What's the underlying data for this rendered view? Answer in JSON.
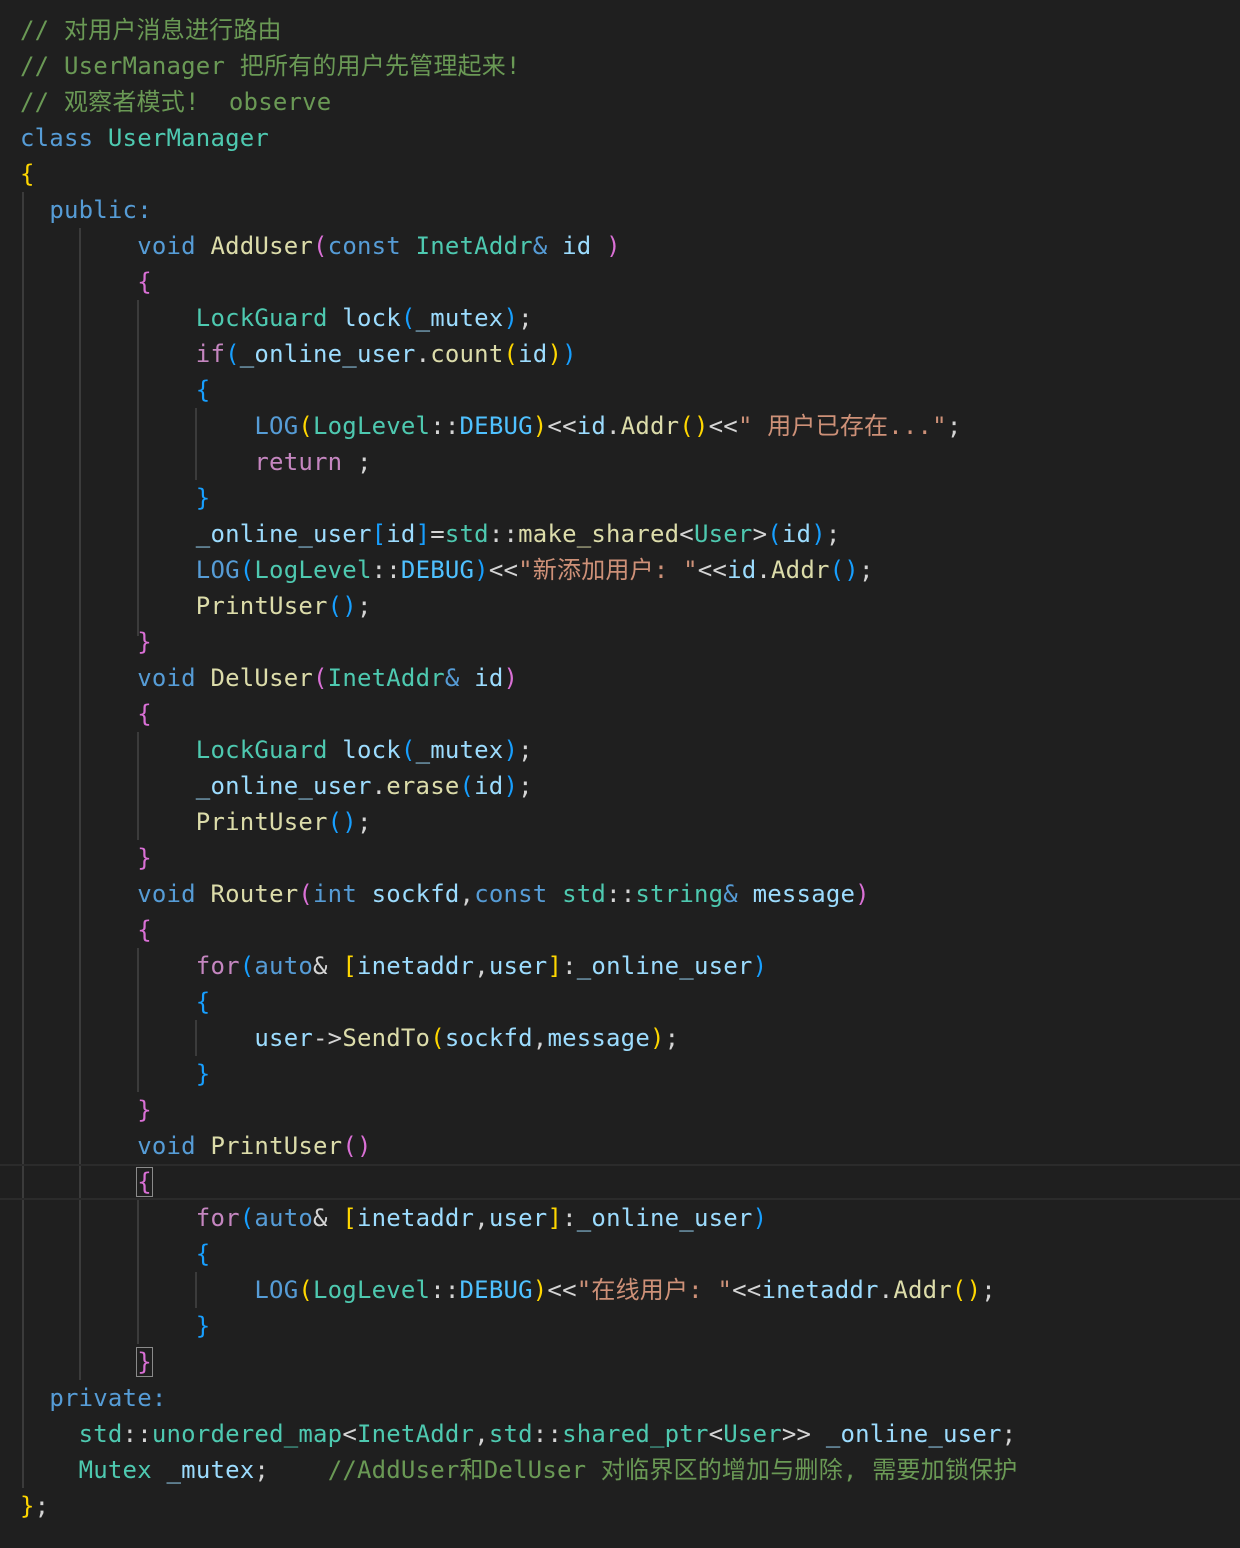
{
  "colors": {
    "background": "#1f1f1f",
    "comment": "#6a9955",
    "keyword": "#569cd6",
    "control": "#c586c0",
    "type": "#4ec9b0",
    "function": "#dcdcaa",
    "variable": "#9cdcfe",
    "string": "#ce9178",
    "punctuation": "#d4d4d4",
    "enum_member": "#4fc1ff",
    "bracket_level_1": "#ffd700",
    "bracket_level_2": "#da70d6",
    "bracket_level_3": "#179fff",
    "indent_guide": "#3b3b3b"
  },
  "code_lines": [
    {
      "tokens": [
        {
          "t": "// 对用户消息进行路由",
          "c": "comment"
        }
      ]
    },
    {
      "tokens": [
        {
          "t": "// UserManager 把所有的用户先管理起来!",
          "c": "comment"
        }
      ]
    },
    {
      "tokens": [
        {
          "t": "// 观察者模式!  observe",
          "c": "comment"
        }
      ]
    },
    {
      "tokens": [
        {
          "t": "class",
          "c": "keyword"
        },
        {
          "t": " ",
          "c": "punc"
        },
        {
          "t": "UserManager",
          "c": "type"
        }
      ]
    },
    {
      "tokens": [
        {
          "t": "{",
          "c": "b1"
        }
      ]
    },
    {
      "tokens": [
        {
          "t": "  ",
          "c": "punc"
        },
        {
          "t": "public",
          "c": "keyword"
        },
        {
          "t": ":",
          "c": "keyword"
        }
      ]
    },
    {
      "tokens": [
        {
          "t": "        ",
          "c": "punc"
        },
        {
          "t": "void",
          "c": "keyword"
        },
        {
          "t": " ",
          "c": "punc"
        },
        {
          "t": "AddUser",
          "c": "func"
        },
        {
          "t": "(",
          "c": "b2"
        },
        {
          "t": "const",
          "c": "keyword"
        },
        {
          "t": " ",
          "c": "punc"
        },
        {
          "t": "InetAddr",
          "c": "type"
        },
        {
          "t": "&",
          "c": "keyword"
        },
        {
          "t": " ",
          "c": "punc"
        },
        {
          "t": "id",
          "c": "var"
        },
        {
          "t": " ",
          "c": "punc"
        },
        {
          "t": ")",
          "c": "b2"
        }
      ]
    },
    {
      "tokens": [
        {
          "t": "        ",
          "c": "punc"
        },
        {
          "t": "{",
          "c": "b2"
        }
      ]
    },
    {
      "tokens": [
        {
          "t": "            ",
          "c": "punc"
        },
        {
          "t": "LockGuard",
          "c": "type"
        },
        {
          "t": " ",
          "c": "punc"
        },
        {
          "t": "lock",
          "c": "var"
        },
        {
          "t": "(",
          "c": "b3"
        },
        {
          "t": "_mutex",
          "c": "var"
        },
        {
          "t": ")",
          "c": "b3"
        },
        {
          "t": ";",
          "c": "punc"
        }
      ]
    },
    {
      "tokens": [
        {
          "t": "            ",
          "c": "punc"
        },
        {
          "t": "if",
          "c": "control"
        },
        {
          "t": "(",
          "c": "b3"
        },
        {
          "t": "_online_user",
          "c": "var"
        },
        {
          "t": ".",
          "c": "punc"
        },
        {
          "t": "count",
          "c": "func"
        },
        {
          "t": "(",
          "c": "b1"
        },
        {
          "t": "id",
          "c": "var"
        },
        {
          "t": ")",
          "c": "b1"
        },
        {
          "t": ")",
          "c": "b3"
        }
      ]
    },
    {
      "tokens": [
        {
          "t": "            ",
          "c": "punc"
        },
        {
          "t": "{",
          "c": "b3"
        }
      ]
    },
    {
      "tokens": [
        {
          "t": "                ",
          "c": "punc"
        },
        {
          "t": "LOG",
          "c": "macro"
        },
        {
          "t": "(",
          "c": "b1"
        },
        {
          "t": "LogLevel",
          "c": "type"
        },
        {
          "t": "::",
          "c": "punc"
        },
        {
          "t": "DEBUG",
          "c": "enum"
        },
        {
          "t": ")",
          "c": "b1"
        },
        {
          "t": "<<",
          "c": "punc"
        },
        {
          "t": "id",
          "c": "var"
        },
        {
          "t": ".",
          "c": "punc"
        },
        {
          "t": "Addr",
          "c": "func"
        },
        {
          "t": "()",
          "c": "b1"
        },
        {
          "t": "<<",
          "c": "punc"
        },
        {
          "t": "\" 用户已存在...\"",
          "c": "string"
        },
        {
          "t": ";",
          "c": "punc"
        }
      ]
    },
    {
      "tokens": [
        {
          "t": "                ",
          "c": "punc"
        },
        {
          "t": "return",
          "c": "control"
        },
        {
          "t": " ;",
          "c": "punc"
        }
      ]
    },
    {
      "tokens": [
        {
          "t": "            ",
          "c": "punc"
        },
        {
          "t": "}",
          "c": "b3"
        }
      ]
    },
    {
      "tokens": [
        {
          "t": "            ",
          "c": "punc"
        },
        {
          "t": "_online_user",
          "c": "var"
        },
        {
          "t": "[",
          "c": "b3"
        },
        {
          "t": "id",
          "c": "var"
        },
        {
          "t": "]",
          "c": "b3"
        },
        {
          "t": "=",
          "c": "punc"
        },
        {
          "t": "std",
          "c": "type"
        },
        {
          "t": "::",
          "c": "punc"
        },
        {
          "t": "make_shared",
          "c": "func"
        },
        {
          "t": "<",
          "c": "punc"
        },
        {
          "t": "User",
          "c": "type"
        },
        {
          "t": ">",
          "c": "punc"
        },
        {
          "t": "(",
          "c": "b3"
        },
        {
          "t": "id",
          "c": "var"
        },
        {
          "t": ")",
          "c": "b3"
        },
        {
          "t": ";",
          "c": "punc"
        }
      ]
    },
    {
      "tokens": [
        {
          "t": "            ",
          "c": "punc"
        },
        {
          "t": "LOG",
          "c": "macro"
        },
        {
          "t": "(",
          "c": "b3"
        },
        {
          "t": "LogLevel",
          "c": "type"
        },
        {
          "t": "::",
          "c": "punc"
        },
        {
          "t": "DEBUG",
          "c": "enum"
        },
        {
          "t": ")",
          "c": "b3"
        },
        {
          "t": "<<",
          "c": "punc"
        },
        {
          "t": "\"新添加用户: \"",
          "c": "string"
        },
        {
          "t": "<<",
          "c": "punc"
        },
        {
          "t": "id",
          "c": "var"
        },
        {
          "t": ".",
          "c": "punc"
        },
        {
          "t": "Addr",
          "c": "func"
        },
        {
          "t": "()",
          "c": "b3"
        },
        {
          "t": ";",
          "c": "punc"
        }
      ]
    },
    {
      "tokens": [
        {
          "t": "            ",
          "c": "punc"
        },
        {
          "t": "PrintUser",
          "c": "func"
        },
        {
          "t": "()",
          "c": "b3"
        },
        {
          "t": ";",
          "c": "punc"
        }
      ]
    },
    {
      "tokens": [
        {
          "t": "        ",
          "c": "punc"
        },
        {
          "t": "}",
          "c": "b2"
        }
      ]
    },
    {
      "tokens": [
        {
          "t": "        ",
          "c": "punc"
        },
        {
          "t": "void",
          "c": "keyword"
        },
        {
          "t": " ",
          "c": "punc"
        },
        {
          "t": "DelUser",
          "c": "func"
        },
        {
          "t": "(",
          "c": "b2"
        },
        {
          "t": "InetAddr",
          "c": "type"
        },
        {
          "t": "&",
          "c": "keyword"
        },
        {
          "t": " ",
          "c": "punc"
        },
        {
          "t": "id",
          "c": "var"
        },
        {
          "t": ")",
          "c": "b2"
        }
      ]
    },
    {
      "tokens": [
        {
          "t": "        ",
          "c": "punc"
        },
        {
          "t": "{",
          "c": "b2"
        }
      ]
    },
    {
      "tokens": [
        {
          "t": "            ",
          "c": "punc"
        },
        {
          "t": "LockGuard",
          "c": "type"
        },
        {
          "t": " ",
          "c": "punc"
        },
        {
          "t": "lock",
          "c": "var"
        },
        {
          "t": "(",
          "c": "b3"
        },
        {
          "t": "_mutex",
          "c": "var"
        },
        {
          "t": ")",
          "c": "b3"
        },
        {
          "t": ";",
          "c": "punc"
        }
      ]
    },
    {
      "tokens": [
        {
          "t": "            ",
          "c": "punc"
        },
        {
          "t": "_online_user",
          "c": "var"
        },
        {
          "t": ".",
          "c": "punc"
        },
        {
          "t": "erase",
          "c": "func"
        },
        {
          "t": "(",
          "c": "b3"
        },
        {
          "t": "id",
          "c": "var"
        },
        {
          "t": ")",
          "c": "b3"
        },
        {
          "t": ";",
          "c": "punc"
        }
      ]
    },
    {
      "tokens": [
        {
          "t": "            ",
          "c": "punc"
        },
        {
          "t": "PrintUser",
          "c": "func"
        },
        {
          "t": "()",
          "c": "b3"
        },
        {
          "t": ";",
          "c": "punc"
        }
      ]
    },
    {
      "tokens": [
        {
          "t": "        ",
          "c": "punc"
        },
        {
          "t": "}",
          "c": "b2"
        }
      ]
    },
    {
      "tokens": [
        {
          "t": "        ",
          "c": "punc"
        },
        {
          "t": "void",
          "c": "keyword"
        },
        {
          "t": " ",
          "c": "punc"
        },
        {
          "t": "Router",
          "c": "func"
        },
        {
          "t": "(",
          "c": "b2"
        },
        {
          "t": "int",
          "c": "keyword"
        },
        {
          "t": " ",
          "c": "punc"
        },
        {
          "t": "sockfd",
          "c": "var"
        },
        {
          "t": ",",
          "c": "punc"
        },
        {
          "t": "const",
          "c": "keyword"
        },
        {
          "t": " ",
          "c": "punc"
        },
        {
          "t": "std",
          "c": "type"
        },
        {
          "t": "::",
          "c": "punc"
        },
        {
          "t": "string",
          "c": "type"
        },
        {
          "t": "&",
          "c": "keyword"
        },
        {
          "t": " ",
          "c": "punc"
        },
        {
          "t": "message",
          "c": "var"
        },
        {
          "t": ")",
          "c": "b2"
        }
      ]
    },
    {
      "tokens": [
        {
          "t": "        ",
          "c": "punc"
        },
        {
          "t": "{",
          "c": "b2"
        }
      ]
    },
    {
      "tokens": [
        {
          "t": "            ",
          "c": "punc"
        },
        {
          "t": "for",
          "c": "control"
        },
        {
          "t": "(",
          "c": "b3"
        },
        {
          "t": "auto",
          "c": "keyword"
        },
        {
          "t": "&",
          "c": "punc"
        },
        {
          "t": " ",
          "c": "punc"
        },
        {
          "t": "[",
          "c": "b1"
        },
        {
          "t": "inetaddr",
          "c": "var"
        },
        {
          "t": ",",
          "c": "punc"
        },
        {
          "t": "user",
          "c": "var"
        },
        {
          "t": "]",
          "c": "b1"
        },
        {
          "t": ":",
          "c": "punc"
        },
        {
          "t": "_online_user",
          "c": "var"
        },
        {
          "t": ")",
          "c": "b3"
        }
      ]
    },
    {
      "tokens": [
        {
          "t": "            ",
          "c": "punc"
        },
        {
          "t": "{",
          "c": "b3"
        }
      ]
    },
    {
      "tokens": [
        {
          "t": "                ",
          "c": "punc"
        },
        {
          "t": "user",
          "c": "var"
        },
        {
          "t": "->",
          "c": "punc"
        },
        {
          "t": "SendTo",
          "c": "func"
        },
        {
          "t": "(",
          "c": "b1"
        },
        {
          "t": "sockfd",
          "c": "var"
        },
        {
          "t": ",",
          "c": "punc"
        },
        {
          "t": "message",
          "c": "var"
        },
        {
          "t": ")",
          "c": "b1"
        },
        {
          "t": ";",
          "c": "punc"
        }
      ]
    },
    {
      "tokens": [
        {
          "t": "            ",
          "c": "punc"
        },
        {
          "t": "}",
          "c": "b3"
        }
      ]
    },
    {
      "tokens": [
        {
          "t": "        ",
          "c": "punc"
        },
        {
          "t": "}",
          "c": "b2"
        }
      ]
    },
    {
      "tokens": [
        {
          "t": "        ",
          "c": "punc"
        },
        {
          "t": "void",
          "c": "keyword"
        },
        {
          "t": " ",
          "c": "punc"
        },
        {
          "t": "PrintUser",
          "c": "func"
        },
        {
          "t": "()",
          "c": "b2"
        }
      ]
    },
    {
      "tokens": [
        {
          "t": "        ",
          "c": "punc"
        },
        {
          "t": "{",
          "c": "b2",
          "boxed": true
        }
      ],
      "current": true
    },
    {
      "tokens": [
        {
          "t": "            ",
          "c": "punc"
        },
        {
          "t": "for",
          "c": "control"
        },
        {
          "t": "(",
          "c": "b3"
        },
        {
          "t": "auto",
          "c": "keyword"
        },
        {
          "t": "&",
          "c": "punc"
        },
        {
          "t": " ",
          "c": "punc"
        },
        {
          "t": "[",
          "c": "b1"
        },
        {
          "t": "inetaddr",
          "c": "var"
        },
        {
          "t": ",",
          "c": "punc"
        },
        {
          "t": "user",
          "c": "var"
        },
        {
          "t": "]",
          "c": "b1"
        },
        {
          "t": ":",
          "c": "punc"
        },
        {
          "t": "_online_user",
          "c": "var"
        },
        {
          "t": ")",
          "c": "b3"
        }
      ]
    },
    {
      "tokens": [
        {
          "t": "            ",
          "c": "punc"
        },
        {
          "t": "{",
          "c": "b3"
        }
      ]
    },
    {
      "tokens": [
        {
          "t": "                ",
          "c": "punc"
        },
        {
          "t": "LOG",
          "c": "macro"
        },
        {
          "t": "(",
          "c": "b1"
        },
        {
          "t": "LogLevel",
          "c": "type"
        },
        {
          "t": "::",
          "c": "punc"
        },
        {
          "t": "DEBUG",
          "c": "enum"
        },
        {
          "t": ")",
          "c": "b1"
        },
        {
          "t": "<<",
          "c": "punc"
        },
        {
          "t": "\"在线用户: \"",
          "c": "string"
        },
        {
          "t": "<<",
          "c": "punc"
        },
        {
          "t": "inetaddr",
          "c": "var"
        },
        {
          "t": ".",
          "c": "punc"
        },
        {
          "t": "Addr",
          "c": "func"
        },
        {
          "t": "()",
          "c": "b1"
        },
        {
          "t": ";",
          "c": "punc"
        }
      ]
    },
    {
      "tokens": [
        {
          "t": "            ",
          "c": "punc"
        },
        {
          "t": "}",
          "c": "b3"
        }
      ]
    },
    {
      "tokens": [
        {
          "t": "        ",
          "c": "punc"
        },
        {
          "t": "}",
          "c": "b2",
          "boxed": true
        }
      ]
    },
    {
      "tokens": [
        {
          "t": "  ",
          "c": "punc"
        },
        {
          "t": "private",
          "c": "keyword"
        },
        {
          "t": ":",
          "c": "keyword"
        }
      ]
    },
    {
      "tokens": [
        {
          "t": "    ",
          "c": "punc"
        },
        {
          "t": "std",
          "c": "type"
        },
        {
          "t": "::",
          "c": "punc"
        },
        {
          "t": "unordered_map",
          "c": "type"
        },
        {
          "t": "<",
          "c": "punc"
        },
        {
          "t": "InetAddr",
          "c": "type"
        },
        {
          "t": ",",
          "c": "punc"
        },
        {
          "t": "std",
          "c": "type"
        },
        {
          "t": "::",
          "c": "punc"
        },
        {
          "t": "shared_ptr",
          "c": "type"
        },
        {
          "t": "<",
          "c": "punc"
        },
        {
          "t": "User",
          "c": "type"
        },
        {
          "t": ">>",
          "c": "punc"
        },
        {
          "t": " ",
          "c": "punc"
        },
        {
          "t": "_online_user",
          "c": "var"
        },
        {
          "t": ";",
          "c": "punc"
        }
      ]
    },
    {
      "tokens": [
        {
          "t": "    ",
          "c": "punc"
        },
        {
          "t": "Mutex",
          "c": "type"
        },
        {
          "t": " ",
          "c": "punc"
        },
        {
          "t": "_mutex",
          "c": "var"
        },
        {
          "t": ";",
          "c": "punc"
        },
        {
          "t": "    ",
          "c": "punc"
        },
        {
          "t": "//AddUser和DelUser 对临界区的增加与删除, 需要加锁保护",
          "c": "comment"
        }
      ]
    },
    {
      "tokens": [
        {
          "t": "}",
          "c": "b1"
        },
        {
          "t": ";",
          "c": "punc"
        }
      ]
    }
  ]
}
